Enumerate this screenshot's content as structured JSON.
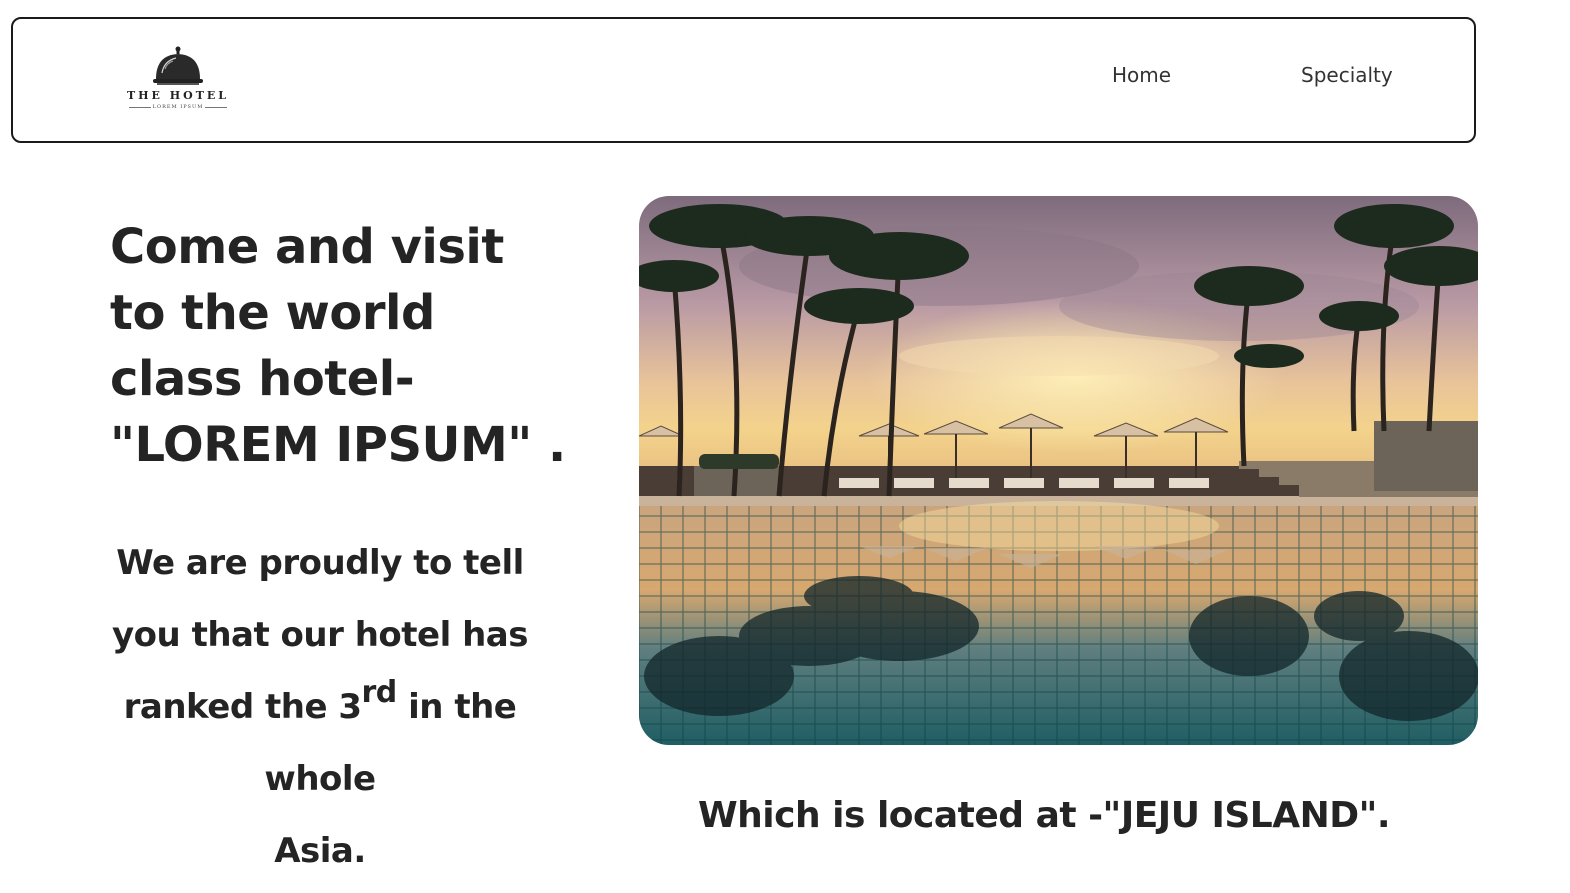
{
  "brand": {
    "title": "THE HOTEL",
    "subtitle": "LOREM IPSUM",
    "icon": "service-bell-icon"
  },
  "nav": {
    "items": [
      {
        "label": "Home"
      },
      {
        "label": "Specialty"
      }
    ]
  },
  "hero": {
    "headline": "Come and visit to the world class hotel-\"LOREM IPSUM\" .",
    "body_before": "We are proudly to tell you that our hotel has ranked the 3",
    "body_sup": "rd",
    "body_after_1": " in the whole",
    "body_after_2": "Asia.",
    "location": "Which is located at -\"JEJU ISLAND\".",
    "image_description_icon": "pool-sunset-image"
  },
  "colors": {
    "text": "#242424",
    "border": "#1a1a1a",
    "background": "#ffffff"
  }
}
